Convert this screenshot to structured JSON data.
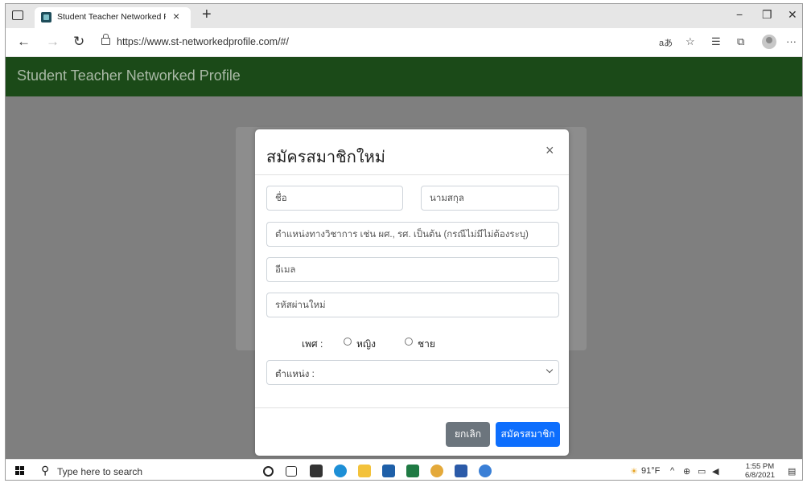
{
  "browser": {
    "tab_title": "Student Teacher Networked Profi",
    "tab_close": "×",
    "new_tab": "+",
    "url": "https://www.st-networkedprofile.com/#/",
    "read_aloud": "aあ",
    "favorites_star": "☆",
    "favorites_list": "☰",
    "collections": "⧉",
    "menu": "···",
    "minimize": "−",
    "restore": "❐",
    "close": "✕"
  },
  "page": {
    "brand": "Student Teacher Networked Profile"
  },
  "modal": {
    "title": "สมัครสมาชิกใหม่",
    "close": "×",
    "first_name_placeholder": "ชื่อ",
    "last_name_placeholder": "นามสกุล",
    "academic_title_placeholder": "ตำแหน่งทางวิชาการ เช่น ผศ., รศ. เป็นต้น (กรณีไม่มีไม่ต้องระบุ)",
    "email_placeholder": "อีเมล",
    "password_placeholder": "รหัสผ่านใหม่",
    "gender_label": "เพศ :",
    "gender_female": "หญิง",
    "gender_male": "ชาย",
    "position_select": "ตำแหน่ง :",
    "cancel": "ยกเลิก",
    "submit": "สมัครสมาชิก"
  },
  "taskbar": {
    "search_placeholder": "Type here to search",
    "weather": "91°F",
    "time": "1:55 PM",
    "date": "6/8/2021"
  },
  "colors": {
    "navbar": "#1b4a18",
    "primary_button": "#0d6efd",
    "secondary_button": "#6c757d",
    "backdrop": "#7f7f7f"
  }
}
